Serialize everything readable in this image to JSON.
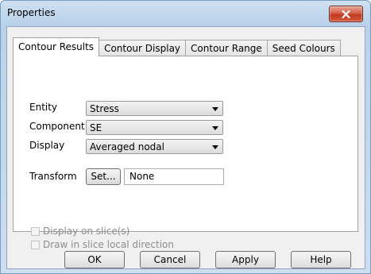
{
  "window": {
    "title": "Properties"
  },
  "tabs": [
    {
      "label": "Contour Results",
      "active": true
    },
    {
      "label": "Contour Display",
      "active": false
    },
    {
      "label": "Contour Range",
      "active": false
    },
    {
      "label": "Seed Colours",
      "active": false
    }
  ],
  "fields": {
    "entity": {
      "label": "Entity",
      "value": "Stress"
    },
    "component": {
      "label": "Component",
      "value": "SE"
    },
    "display": {
      "label": "Display",
      "value": "Averaged nodal"
    },
    "transform": {
      "label": "Transform",
      "button": "Set...",
      "value": "None"
    }
  },
  "checkboxes": {
    "display_on_slice": {
      "label": "Display on slice(s)",
      "checked": false,
      "enabled": false
    },
    "draw_in_slice": {
      "label": "Draw in slice local direction",
      "checked": false,
      "enabled": false
    }
  },
  "buttons": {
    "ok": "OK",
    "cancel": "Cancel",
    "apply": "Apply",
    "help": "Help"
  },
  "colors": {
    "close_button": "#c94a30",
    "dialog_background": "#f0f0f0",
    "window_frame": "#b9d1ea"
  }
}
